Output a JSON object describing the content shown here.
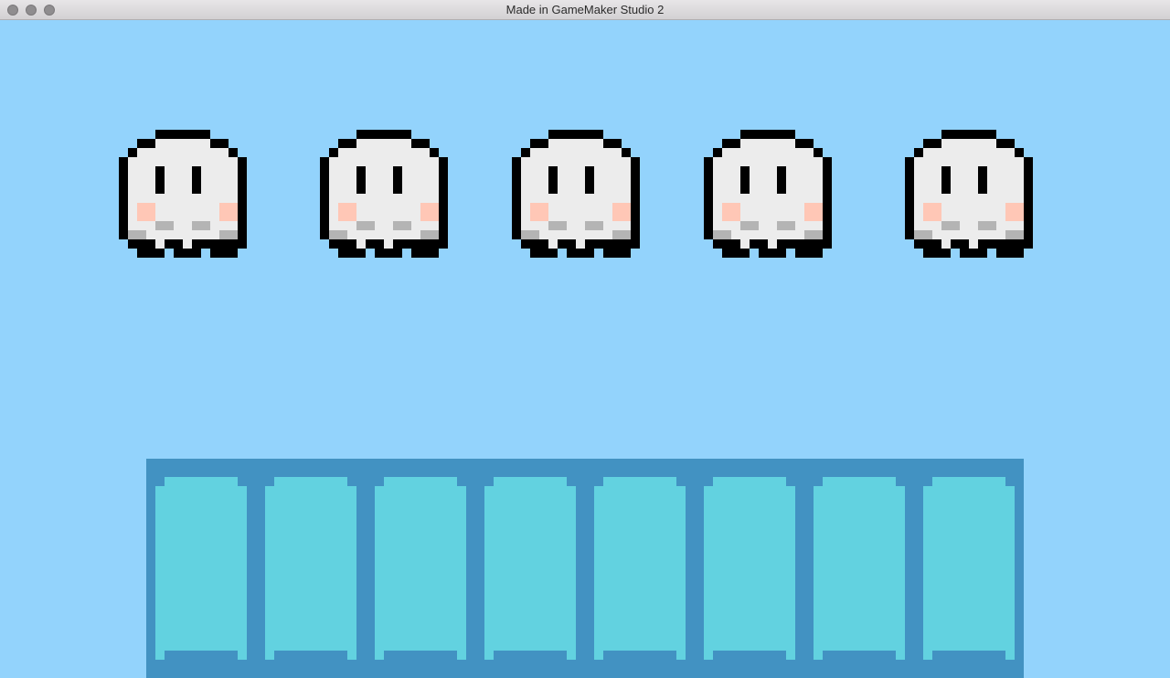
{
  "window": {
    "title": "Made in GameMaker Studio 2",
    "buttons": [
      "close",
      "minimize",
      "zoom"
    ]
  },
  "game": {
    "background_color": "#93d3fc",
    "enemies": [
      {
        "type": "ghost"
      },
      {
        "type": "ghost"
      },
      {
        "type": "ghost"
      },
      {
        "type": "ghost"
      },
      {
        "type": "ghost"
      }
    ],
    "card_slots": [
      {
        "state": "empty"
      },
      {
        "state": "empty"
      },
      {
        "state": "empty"
      },
      {
        "state": "empty"
      },
      {
        "state": "empty"
      },
      {
        "state": "empty"
      },
      {
        "state": "empty"
      },
      {
        "state": "empty"
      }
    ],
    "colors": {
      "ghost_outline": "#000000",
      "ghost_body": "#ececec",
      "ghost_shade": "#b4b4b4",
      "ghost_blush": "#ffc7b6",
      "tray_frame": "#4292c2",
      "slot_fill": "#62d2e0"
    }
  }
}
